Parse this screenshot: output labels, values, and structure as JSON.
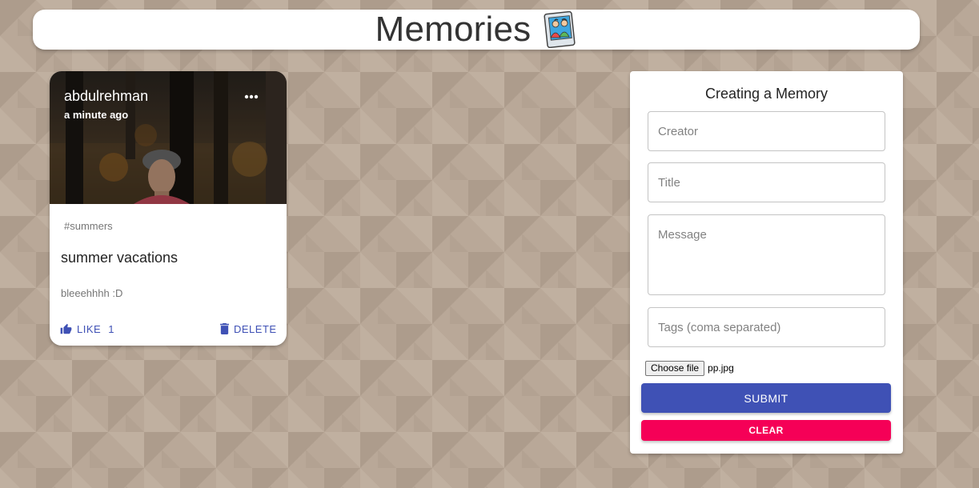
{
  "app": {
    "title": "Memories",
    "logo_icon": "photo-album-icon",
    "background_color": "#b9a898"
  },
  "posts": [
    {
      "creator": "abdulrehman",
      "time": "a minute ago",
      "tags": "#summers",
      "title": "summer vacations",
      "message": "bleeehhhh :D",
      "like_label": "LIKE",
      "like_count": "1",
      "delete_label": "DELETE",
      "image": "photo of a man in a forest",
      "more_icon": "more-horiz-icon",
      "like_icon": "thumb-up-icon",
      "delete_icon": "trash-icon"
    }
  ],
  "form": {
    "heading": "Creating a Memory",
    "creator": {
      "placeholder": "Creator",
      "value": ""
    },
    "title": {
      "placeholder": "Title",
      "value": ""
    },
    "message": {
      "placeholder": "Message",
      "value": ""
    },
    "tags": {
      "placeholder": "Tags (coma separated)",
      "value": ""
    },
    "file": {
      "button_label": "Choose file",
      "file_name": "pp.jpg"
    },
    "submit_label": "SUBMIT",
    "clear_label": "CLEAR"
  },
  "colors": {
    "primary": "#3f51b5",
    "secondary": "#f50057",
    "surface": "#ffffff"
  }
}
